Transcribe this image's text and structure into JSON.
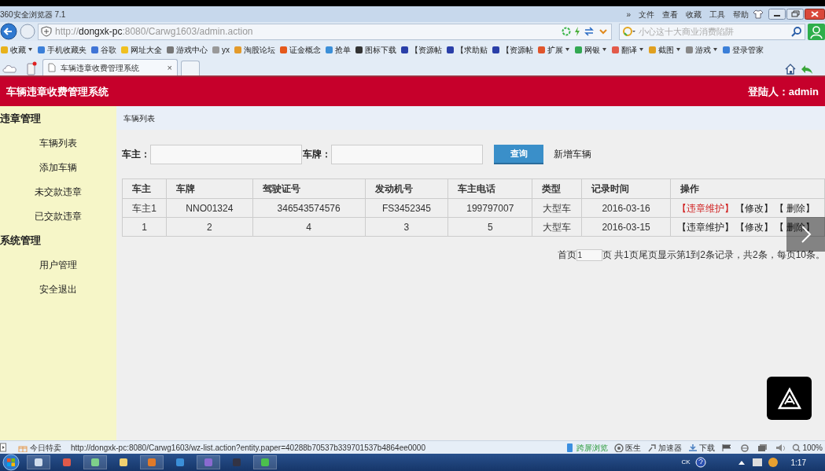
{
  "browser": {
    "title": "360安全浏览器 7.1",
    "menu": [
      "»",
      "文件",
      "查看",
      "收藏",
      "工具",
      "帮助"
    ],
    "address": {
      "scheme": "http://",
      "host": "dongxk-pc",
      "path": ":8080/Carwg1603/admin.action"
    },
    "search": {
      "placeholder": "小心这十大商业消费陷阱"
    },
    "bookmarks": [
      {
        "label": "收藏",
        "dropdown": true
      },
      {
        "label": "手机收藏夹",
        "dropdown": false
      },
      {
        "label": "谷歌",
        "dropdown": false
      },
      {
        "label": "网址大全",
        "dropdown": false
      },
      {
        "label": "游戏中心",
        "dropdown": false
      },
      {
        "label": "yx",
        "dropdown": false
      },
      {
        "label": "淘股论坛",
        "dropdown": false
      },
      {
        "label": "证金概念",
        "dropdown": false
      },
      {
        "label": "抢单",
        "dropdown": false
      },
      {
        "label": "图标下载",
        "dropdown": false
      },
      {
        "label": "【资源帖",
        "dropdown": false
      },
      {
        "label": "【求助贴",
        "dropdown": false
      },
      {
        "label": "【资源帖",
        "dropdown": false
      },
      {
        "label": "扩展",
        "dropdown": true
      },
      {
        "label": "网银",
        "dropdown": true
      },
      {
        "label": "翻译",
        "dropdown": true
      },
      {
        "label": "截图",
        "dropdown": true
      },
      {
        "label": "游戏",
        "dropdown": true
      },
      {
        "label": "登录管家",
        "dropdown": false
      }
    ],
    "tabs": [
      {
        "label": "车辆违章收费管理系统",
        "selected": true,
        "close": "×"
      }
    ]
  },
  "app": {
    "title": "车辆违章收费管理系统",
    "user": "登陆人：admin"
  },
  "sidebar": [
    {
      "label": "违章管理",
      "children": [
        {
          "label": "车辆列表"
        },
        {
          "label": "添加车辆"
        },
        {
          "label": "未交款违章"
        },
        {
          "label": "已交款违章"
        }
      ]
    },
    {
      "label": "系统管理",
      "children": [
        {
          "label": "用户管理"
        },
        {
          "label": "安全退出"
        }
      ]
    }
  ],
  "breadcrumb": "车辆列表",
  "filters": [
    {
      "label": "车主："
    },
    {
      "label": "车牌："
    }
  ],
  "search_button": "查询",
  "add_link": "新增车辆",
  "table": {
    "columns": [
      "车主",
      "车牌",
      "驾驶证号",
      "发动机号",
      "车主电话",
      "类型",
      "记录时间",
      "操作"
    ],
    "rows": [
      {
        "cells": [
          "车主1",
          "NNO01324",
          "346543574576",
          "FS3452345",
          "199797007",
          "大型车",
          "2016-03-16"
        ],
        "actions": [
          {
            "label": "【违章维护】",
            "highlighted": true
          },
          {
            "label": "【修改】",
            "highlighted": false
          },
          {
            "label": "【 删除】",
            "highlighted": false
          }
        ]
      },
      {
        "cells": [
          "1",
          "2",
          "4",
          "3",
          "5",
          "大型车",
          "2016-03-15"
        ],
        "actions": [
          {
            "label": "【违章维护】",
            "highlighted": false
          },
          {
            "label": "【修改】",
            "highlighted": false
          },
          {
            "label": "【 删除】",
            "highlighted": false
          }
        ]
      }
    ]
  },
  "pagination": {
    "first": "首页",
    "page": "1",
    "summary": "页 共1页尾页显示第1到2条记录，共2条，每页10条。"
  },
  "status_bar": {
    "promo": "今日特卖",
    "url": "http://dongxk-pc:8080/Carwg1603/wz-list.action?entity.paper=40288b70537b339701537b4864ee0000",
    "items": [
      "跨屏浏览",
      "医生",
      "加速器",
      "下载"
    ],
    "zoom": "100%"
  },
  "taskbar": {
    "ime": "CK",
    "clock": "1:17"
  }
}
